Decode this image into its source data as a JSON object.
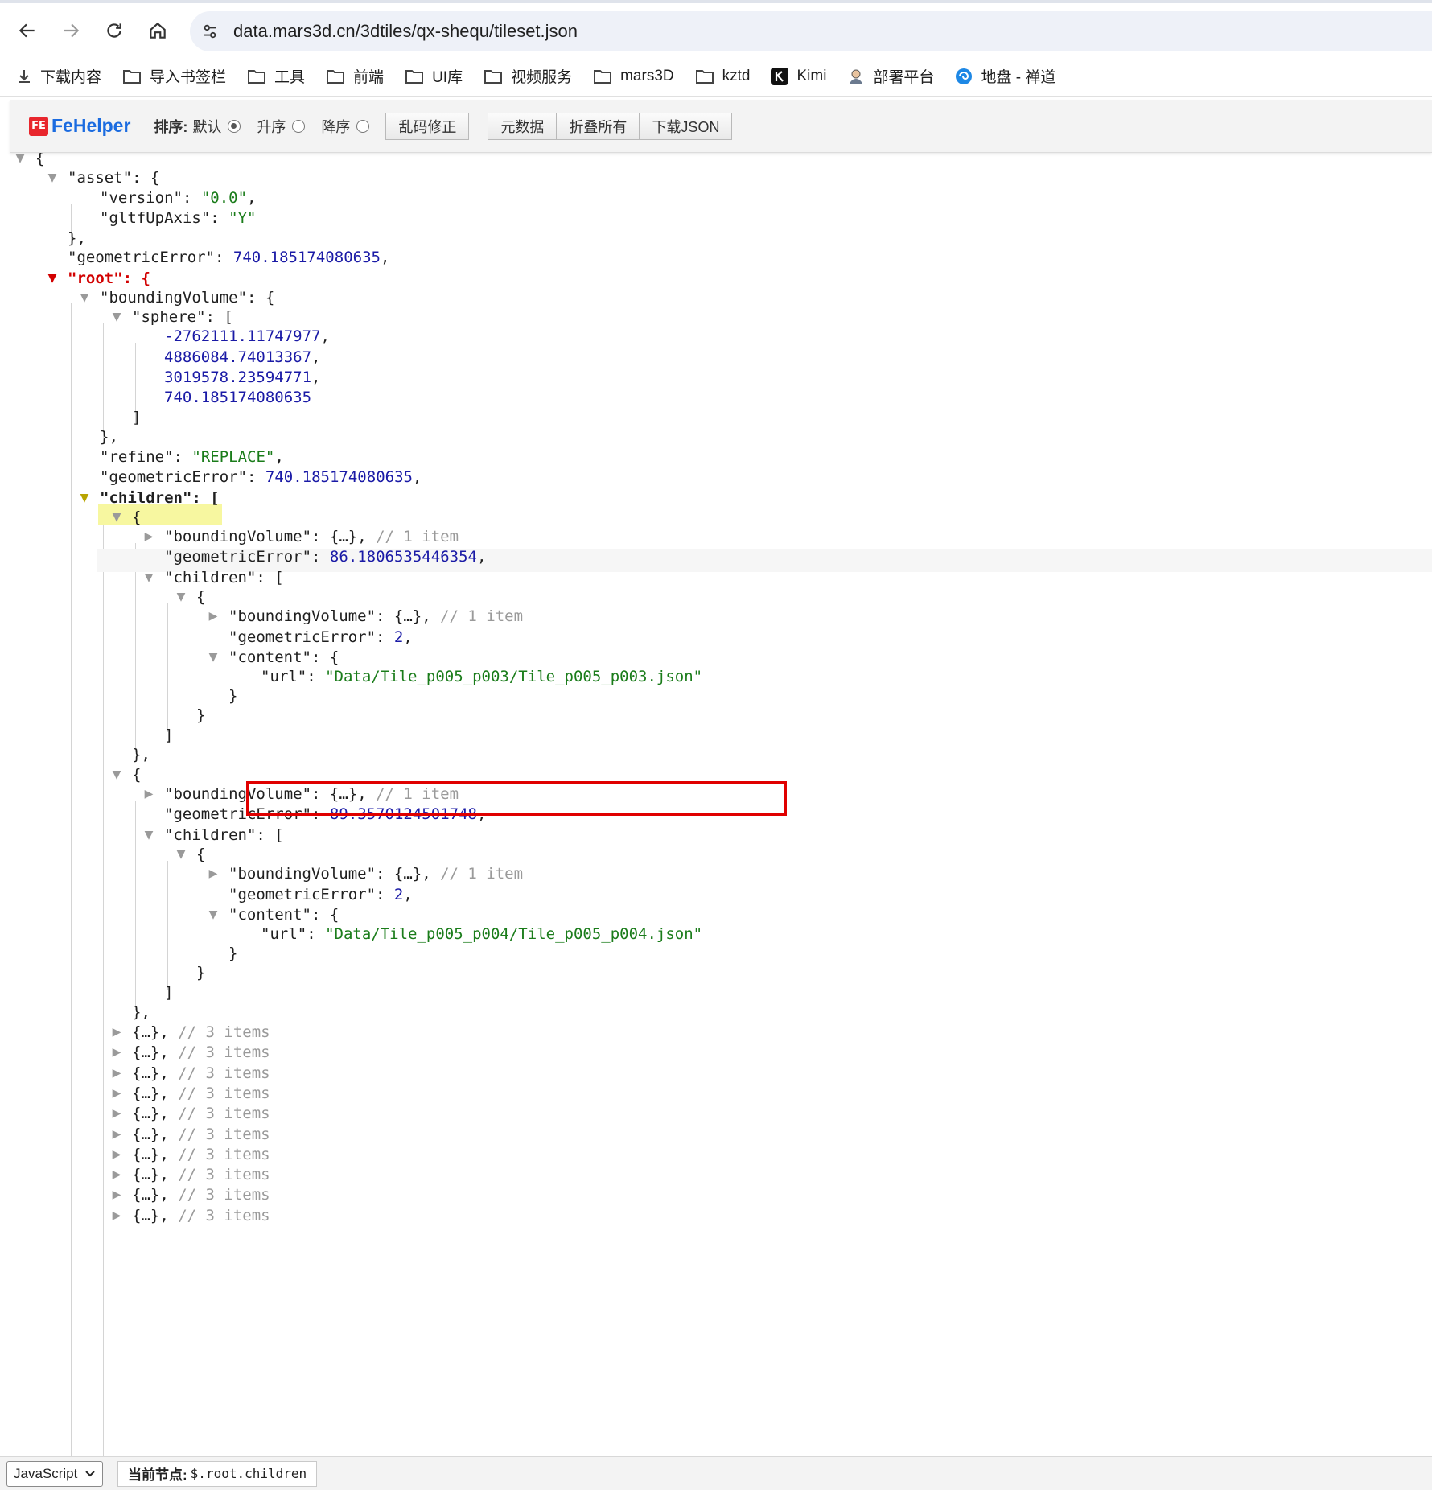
{
  "browser": {
    "address": "data.mars3d.cn/3dtiles/qx-shequ/tileset.json",
    "bookmarks": [
      {
        "label": "下载内容",
        "icon": "download-icon"
      },
      {
        "label": "导入书签栏",
        "icon": "folder-icon"
      },
      {
        "label": "工具",
        "icon": "folder-icon"
      },
      {
        "label": "前端",
        "icon": "folder-icon"
      },
      {
        "label": "UI库",
        "icon": "folder-icon"
      },
      {
        "label": "视频服务",
        "icon": "folder-icon"
      },
      {
        "label": "mars3D",
        "icon": "folder-icon"
      },
      {
        "label": "kztd",
        "icon": "folder-icon"
      },
      {
        "label": "Kimi",
        "icon": "kimi-icon"
      },
      {
        "label": "部署平台",
        "icon": "avatar-icon"
      },
      {
        "label": "地盘 - 禅道",
        "icon": "zentao-icon"
      }
    ]
  },
  "fehelper": {
    "logo_badge": "FE",
    "logo_name": "FeHelper",
    "sort_label": "排序:",
    "sort_default": "默认",
    "sort_asc": "升序",
    "sort_desc": "降序",
    "btn_fix": "乱码修正",
    "btn_meta": "元数据",
    "btn_fold": "折叠所有",
    "btn_download": "下载JSON"
  },
  "json": {
    "asset_version": "\"0.0\"",
    "asset_upaxis": "\"Y\"",
    "geometric_error": "740.185174080635",
    "sphere": [
      "-2762111.11747977",
      "4886084.74013367",
      "3019578.23594771",
      "740.185174080635"
    ],
    "refine": "\"REPLACE\"",
    "root_geometric_error": "740.185174080635",
    "child1_geometric_error": "86.1806535446354",
    "child1_inner_geometric_error": "2",
    "child1_url": "\"Data/Tile_p005_p003/Tile_p005_p003.json\"",
    "child2_geometric_error": "89.3570124501748",
    "child2_inner_geometric_error": "2",
    "child2_url": "\"Data/Tile_p005_p004/Tile_p005_p004.json\"",
    "collapsed_comment_one": "// 1 item",
    "collapsed_comment_three": "// 3 items",
    "collapsed_obj_count": 10
  },
  "status": {
    "language": "JavaScript",
    "node_label": "当前节点:",
    "node_path": "$.root.children"
  }
}
